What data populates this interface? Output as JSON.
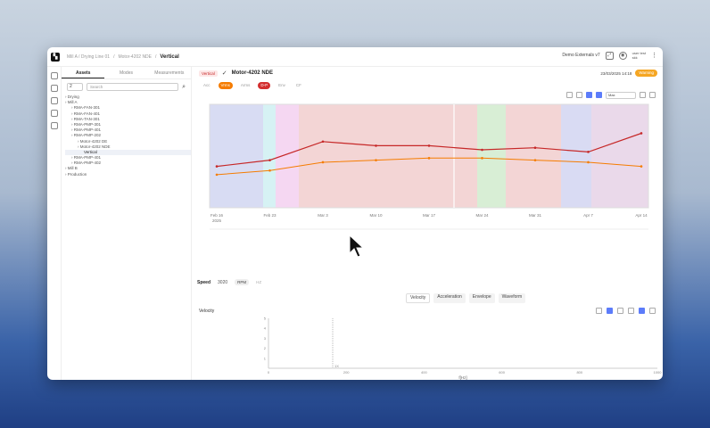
{
  "header": {
    "crumbs": [
      "Mill A / Drying Line 01",
      "Motor-4202 NDE"
    ],
    "active_crumb": "Vertical",
    "workspace": "Demo Externals v7",
    "user_line1": "user test",
    "user_line2": "skk"
  },
  "rail": {
    "icons": [
      "home-icon",
      "assets-icon",
      "folder-icon",
      "settings-icon",
      "chat-icon"
    ]
  },
  "sidebar": {
    "tabs": [
      "Assets",
      "Modes",
      "Measurements"
    ],
    "level": "2",
    "search_placeholder": "Search",
    "tree": [
      {
        "label": "Drying",
        "depth": 0
      },
      {
        "label": "Mill A",
        "depth": 0
      },
      {
        "label": "RMA-FAN-301",
        "depth": 1
      },
      {
        "label": "RMA-FAN-401",
        "depth": 1
      },
      {
        "label": "RMA-TAN-301",
        "depth": 1
      },
      {
        "label": "RMA-PMP-301",
        "depth": 1
      },
      {
        "label": "RMA-PMP-401",
        "depth": 1
      },
      {
        "label": "RMA-PMP-202",
        "depth": 1
      },
      {
        "label": "Motor-4202 DE",
        "depth": 2
      },
      {
        "label": "Motor-4202 NDE",
        "depth": 2
      },
      {
        "label": "Vertical",
        "depth": 3,
        "selected": true
      },
      {
        "label": "RMA-PMP-401",
        "depth": 1
      },
      {
        "label": "RMA-PMP-402",
        "depth": 1
      },
      {
        "label": "Mill B",
        "depth": 0
      },
      {
        "label": "Production",
        "depth": 0
      }
    ]
  },
  "asset": {
    "badge": "Vertical",
    "title": "Motor-4202 NDE",
    "timestamp": "23/03/2025 14:18",
    "status": "Warning"
  },
  "filters": [
    {
      "label": "Acc",
      "style": "plain"
    },
    {
      "label": "Vrms",
      "style": "orange"
    },
    {
      "label": "Arms",
      "style": "plain"
    },
    {
      "label": "D-P",
      "style": "red"
    },
    {
      "label": "Env",
      "style": "plain"
    },
    {
      "label": "CF",
      "style": "plain"
    }
  ],
  "range_select": "Max",
  "trend": {
    "x_labels": [
      "Feb 16",
      "Feb 23",
      "Mar 3",
      "Mar 10",
      "Mar 17",
      "Mar 24",
      "Mar 31",
      "Apr 7",
      "Apr 14"
    ],
    "year_label": "2025",
    "colors": {
      "line1": "#c62828",
      "line2": "#f57c00"
    }
  },
  "speed": {
    "label": "Speed",
    "value": "3020",
    "unit_on": "RPM",
    "unit_off": "HZ"
  },
  "subtabs": [
    "Velocity",
    "Acceleration",
    "Envelope",
    "Waveform"
  ],
  "spectrum": {
    "title": "Velocity",
    "x_label": "f[Hz]",
    "y_ticks": [
      "1",
      "2",
      "3",
      "4",
      "5"
    ],
    "x_ticks": [
      "0",
      "200",
      "400",
      "600",
      "800",
      "1000"
    ],
    "marker": "1X"
  },
  "chart_data": {
    "type": "line",
    "title": "",
    "xlabel": "",
    "ylabel": "",
    "categories": [
      "Feb 16",
      "Feb 23",
      "Mar 3",
      "Mar 10",
      "Mar 17",
      "Mar 24",
      "Mar 31",
      "Apr 7",
      "Apr 14"
    ],
    "series": [
      {
        "values": [
          2.0,
          2.3,
          3.2,
          3.0,
          3.0,
          2.8,
          2.9,
          2.7,
          3.6
        ]
      },
      {
        "values": [
          1.6,
          1.8,
          2.2,
          2.3,
          2.4,
          2.4,
          2.3,
          2.2,
          2.0
        ]
      }
    ],
    "ylim": [
      0,
      5
    ]
  }
}
